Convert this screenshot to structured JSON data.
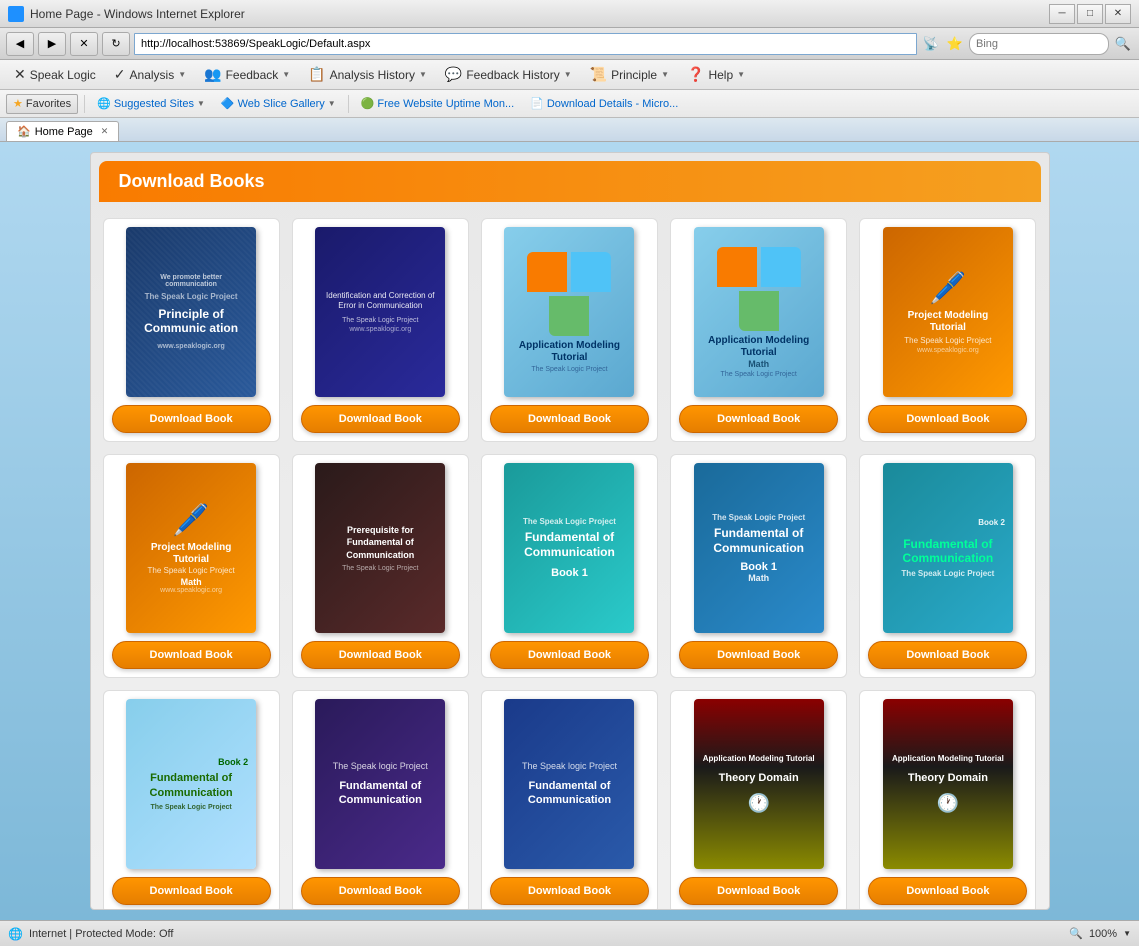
{
  "window": {
    "title": "Home Page - Windows Internet Explorer",
    "address": "http://localhost:53869/SpeakLogic/Default.aspx",
    "search_placeholder": "Bing"
  },
  "nav": {
    "speak_logic": "Speak Logic",
    "analysis": "Analysis",
    "feedback": "Feedback",
    "analysis_history": "Analysis History",
    "feedback_history": "Feedback History",
    "principle": "Principle",
    "help": "Help"
  },
  "favorites": {
    "label": "Favorites",
    "suggested_sites": "Suggested Sites",
    "web_slice_gallery": "Web Slice Gallery",
    "free_uptime": "Free Website Uptime Mon...",
    "download_details": "Download Details - Micro..."
  },
  "tab": {
    "label": "Home Page"
  },
  "page": {
    "title": "Download Books",
    "download_btn_label": "Download Book"
  },
  "books": [
    {
      "id": 1,
      "title": "Principle of Communication",
      "style": "book-1"
    },
    {
      "id": 2,
      "title": "Identification and Correction of Error in Communication",
      "style": "book-2"
    },
    {
      "id": 3,
      "title": "Application Modeling Tutorial",
      "style": "book-3"
    },
    {
      "id": 4,
      "title": "Application Modeling Tutorial Math",
      "style": "book-4"
    },
    {
      "id": 5,
      "title": "Project Modeling Tutorial",
      "style": "book-5"
    },
    {
      "id": 6,
      "title": "Project Modeling Tutorial Math",
      "style": "book-6"
    },
    {
      "id": 7,
      "title": "Prerequisite for Fundamental of Communication",
      "style": "book-7"
    },
    {
      "id": 8,
      "title": "Fundamental of Communication Book 1",
      "style": "book-8"
    },
    {
      "id": 9,
      "title": "Fundamental of Communication Book 1 Math",
      "style": "book-9"
    },
    {
      "id": 10,
      "title": "Fundamental of Communication Book 2",
      "style": "book-10"
    },
    {
      "id": 11,
      "title": "Fundamental of Communication Book 2",
      "style": "book-11"
    },
    {
      "id": 12,
      "title": "Fundamental of Communication",
      "style": "book-12"
    },
    {
      "id": 13,
      "title": "Fundamental of Communication",
      "style": "book-13"
    },
    {
      "id": 14,
      "title": "Application Modeling Tutorial Theory Domain",
      "style": "book-14"
    },
    {
      "id": 15,
      "title": "Application Modeling Tutorial Theory Domain",
      "style": "book-15"
    }
  ],
  "status": {
    "zone": "Internet | Protected Mode: Off",
    "zoom": "100%"
  }
}
